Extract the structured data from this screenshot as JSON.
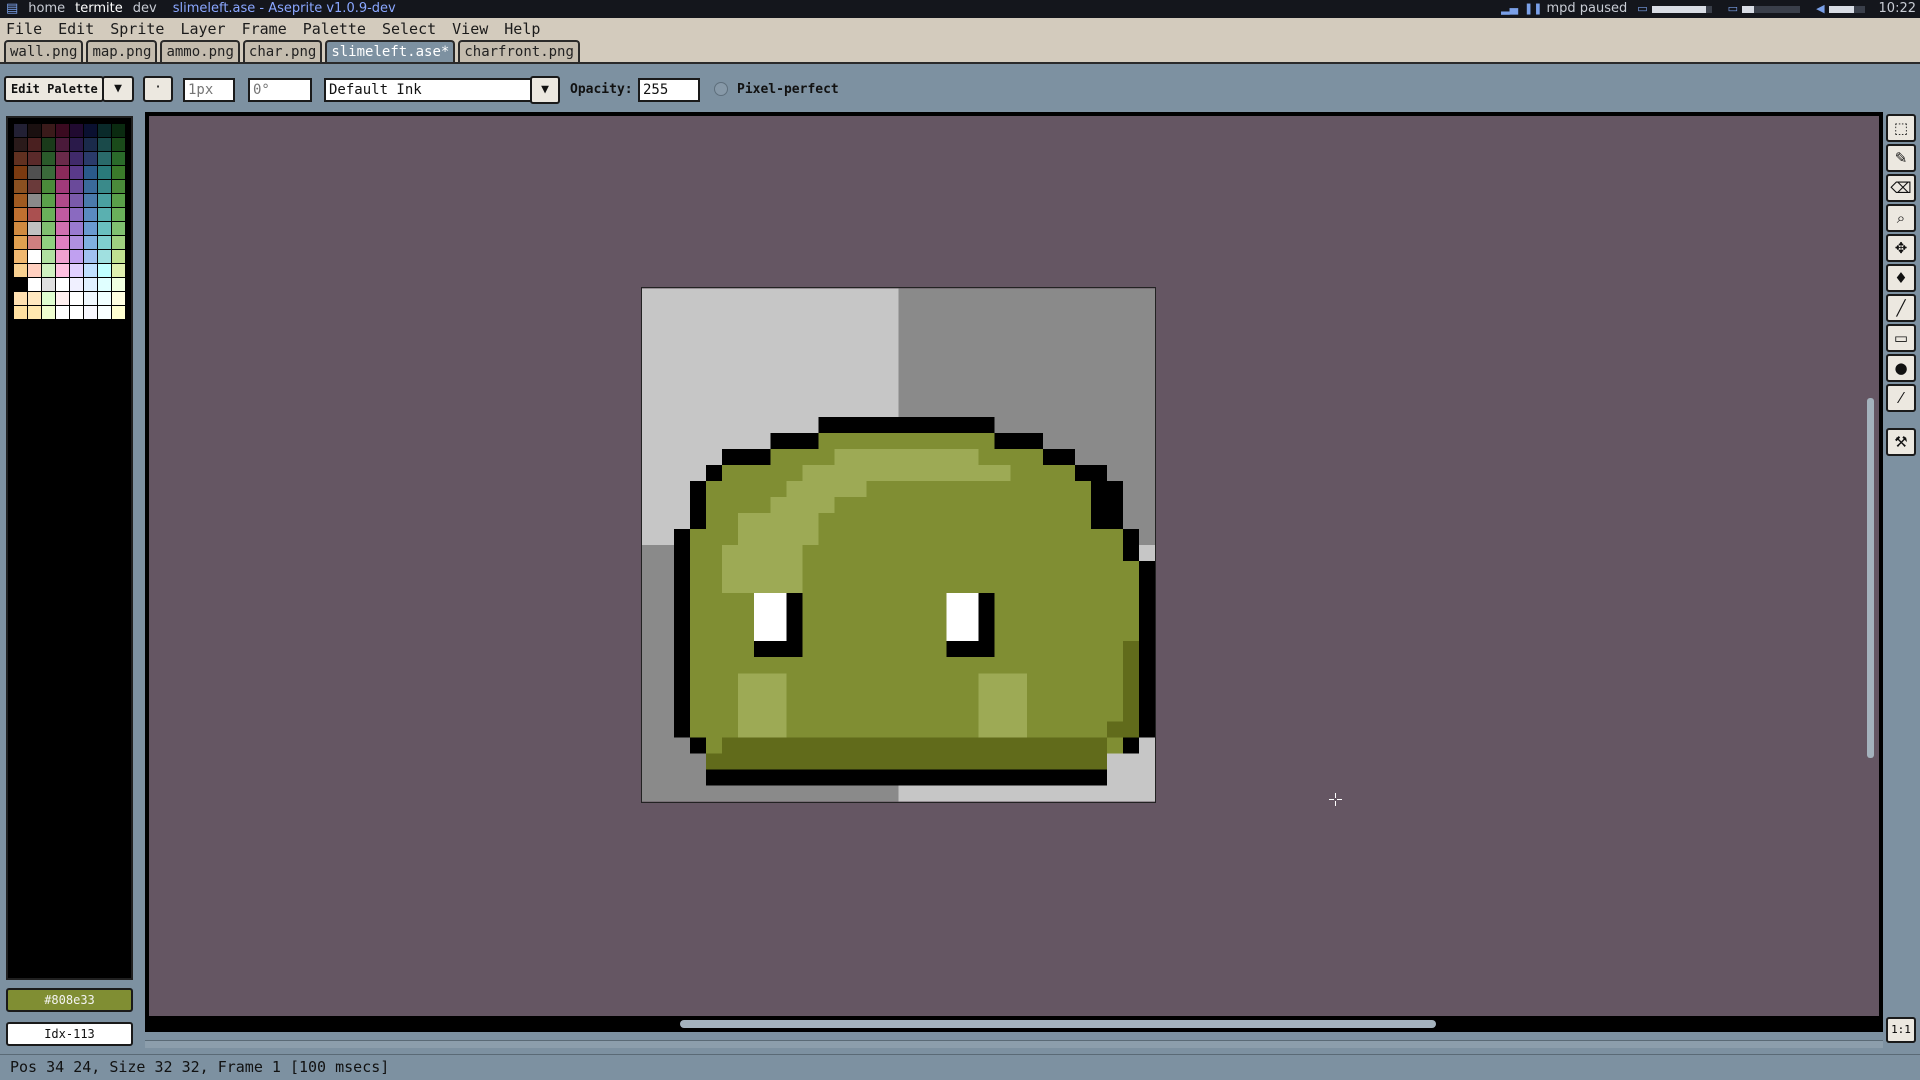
{
  "system_bar": {
    "workspaces": [
      "home",
      "termite",
      "dev"
    ],
    "active_workspace": "termite",
    "window_title": "slimeleft.ase - Aseprite v1.0.9-dev",
    "music_status": "mpd paused",
    "battery_level": 0.9,
    "brightness_level": 0.2,
    "volume_level": 0.7,
    "clock": "10:22"
  },
  "menu": {
    "items": [
      "File",
      "Edit",
      "Sprite",
      "Layer",
      "Frame",
      "Palette",
      "Select",
      "View",
      "Help"
    ]
  },
  "tabs": [
    {
      "label": "wall.png",
      "active": false
    },
    {
      "label": "map.png",
      "active": false
    },
    {
      "label": "ammo.png",
      "active": false
    },
    {
      "label": "char.png",
      "active": false
    },
    {
      "label": "slimeleft.ase*",
      "active": true
    },
    {
      "label": "charfront.png",
      "active": false
    }
  ],
  "toolbar": {
    "edit_palette_label": "Edit Palette",
    "brush_size_placeholder": "1px",
    "brush_angle_placeholder": "0°",
    "ink_selected": "Default Ink",
    "opacity_label": "Opacity:",
    "opacity_value": "255",
    "pixel_perfect_label": "Pixel-perfect",
    "pixel_perfect_checked": false
  },
  "palette": {
    "colors": [
      "#222034",
      "#1a1010",
      "#3a1a1a",
      "#3a0a20",
      "#200a30",
      "#0a1030",
      "#0a2a2a",
      "#0a2a10",
      "#2a1a1a",
      "#4a2020",
      "#1a3a1a",
      "#4a1a3a",
      "#2a1a4a",
      "#1a2a4a",
      "#1a4a4a",
      "#1a4a1a",
      "#603020",
      "#5a2a2a",
      "#2a5a2a",
      "#6a2a4a",
      "#402a6a",
      "#2a3a6a",
      "#2a6a6a",
      "#2a6a2a",
      "#7a3a10",
      "#505050",
      "#3a6a3a",
      "#8a2a5a",
      "#5a3a8a",
      "#2a5a8a",
      "#2a7a7a",
      "#3a7a2a",
      "#8a5020",
      "#6a3a3a",
      "#4a8a3a",
      "#a03a7a",
      "#6a4a9a",
      "#3a6a9a",
      "#3a8a8a",
      "#4a8a3a",
      "#a05a20",
      "#8a8a8a",
      "#5aa04a",
      "#b04a8a",
      "#7a5aaa",
      "#4a7aaa",
      "#4aa0a0",
      "#5aa04a",
      "#c07030",
      "#aa5050",
      "#6ab05a",
      "#c05aa0",
      "#8a6ac0",
      "#5a8ac0",
      "#5ab0b0",
      "#6ab05a",
      "#d08a40",
      "#c0c0c0",
      "#80c070",
      "#d070b0",
      "#9a7ad0",
      "#6a9ad0",
      "#6ac0c0",
      "#80c070",
      "#e0a050",
      "#d08080",
      "#90d080",
      "#e080c0",
      "#b090e0",
      "#80b0e0",
      "#80d0d0",
      "#a0d080",
      "#f0b870",
      "#ffffff",
      "#b0e0a0",
      "#f0a0d0",
      "#c0a0f0",
      "#a0c0f0",
      "#a0e0e0",
      "#c0e090",
      "#f8d090",
      "#ffd0c0",
      "#d0f0c0",
      "#ffc0e0",
      "#e0d0ff",
      "#c0e0ff",
      "#c0ffff",
      "#e0f0b0",
      "#000000",
      "#ffffff",
      "#e0e0e0",
      "#ffffff",
      "#f0f0ff",
      "#e0f0ff",
      "#e0ffff",
      "#f0ffe0",
      "#ffe0b0",
      "#ffe8c0",
      "#e0ffd0",
      "#fff0f0",
      "#ffffff",
      "#f0f8ff",
      "#f0ffff",
      "#ffffe0",
      "#ffe0a0",
      "#ffe8b0",
      "#f0ffd0",
      "#ffffff",
      "#ffffff",
      "#f8f8ff",
      "#f8ffff",
      "#ffffd0"
    ],
    "foreground_color": "#808e33",
    "background_label": "Idx-113"
  },
  "sprite": {
    "name": "slimeleft.ase",
    "width": 32,
    "height": 32,
    "checker_colors": [
      "#c6c6c6",
      "#8a8a8a"
    ]
  },
  "status_bar": {
    "text": "Pos 34 24, Size 32 32, Frame 1 [100 msecs]"
  },
  "zoom_label": "1:1",
  "tools": [
    "rectangular-marquee-icon",
    "pencil-icon",
    "eraser-icon",
    "zoom-icon",
    "move-icon",
    "bucket-icon",
    "line-icon",
    "rectangle-icon",
    "contour-icon",
    "blur-icon",
    "tools-config-icon"
  ]
}
